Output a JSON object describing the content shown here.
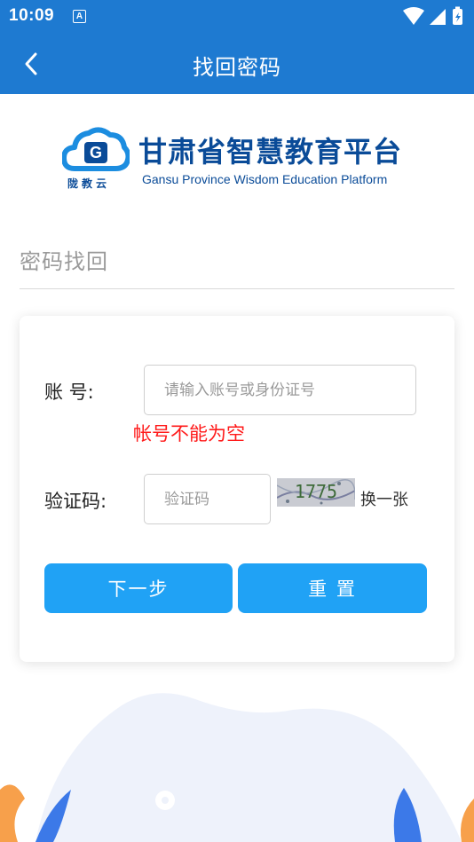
{
  "status_bar": {
    "time": "10:09",
    "notification_letter": "A"
  },
  "nav": {
    "title": "找回密码"
  },
  "brand": {
    "logo_text": "陇教云",
    "logo_letter": "G",
    "title": "甘肃省智慧教育平台",
    "subtitle": "Gansu Province Wisdom Education Platform"
  },
  "section": {
    "title": "密码找回"
  },
  "form": {
    "account_label": "账  号:",
    "account_placeholder": "请输入账号或身份证号",
    "account_value": "",
    "account_error": "帐号不能为空",
    "captcha_label": "验证码:",
    "captcha_placeholder": "验证码",
    "captcha_value": "",
    "captcha_code": "1775",
    "captcha_refresh": "换一张",
    "next_button": "下一步",
    "reset_button": "重 置"
  },
  "colors": {
    "header_bg": "#1E7AD1",
    "button_bg": "#20A2F5",
    "error": "#FF1A1A",
    "brand_text": "#0A4B98"
  }
}
